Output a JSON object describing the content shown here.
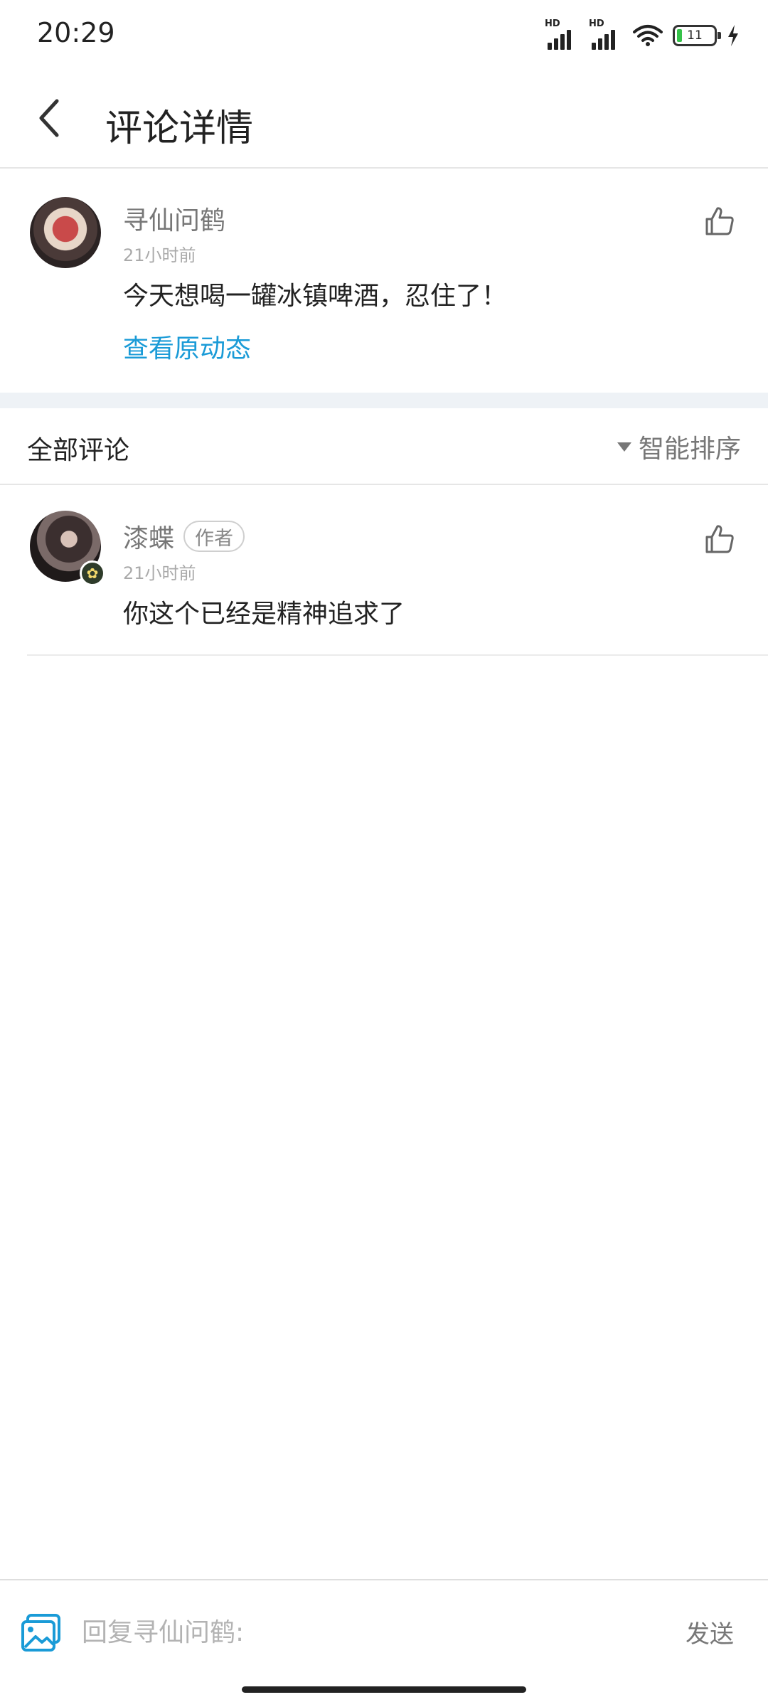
{
  "status_bar": {
    "time": "20:29",
    "signal_1_label": "HD",
    "signal_2_label": "HD",
    "battery_level": "11",
    "icons": [
      "signal-icon",
      "signal-icon",
      "wifi-icon",
      "battery-icon",
      "charging-icon"
    ]
  },
  "header": {
    "title": "评论详情",
    "back_icon": "chevron-left-icon"
  },
  "main_comment": {
    "username": "寻仙问鹤",
    "time": "21小时前",
    "content": "今天想喝一罐冰镇啤酒，忍住了！",
    "view_original": "查看原动态",
    "like_icon": "thumbs-up-icon"
  },
  "comments_section": {
    "title": "全部评论",
    "sort_label": "智能排序"
  },
  "replies": [
    {
      "username": "漆蝶",
      "tag": "作者",
      "time": "21小时前",
      "content": "你这个已经是精神追求了",
      "like_icon": "thumbs-up-icon"
    }
  ],
  "bottom_bar": {
    "placeholder": "回复寻仙问鹤:",
    "send_label": "发送",
    "image_icon": "image-icon"
  },
  "colors": {
    "link": "#1a9bd7",
    "divider_band": "#eef2f6",
    "battery_fill": "#36c24a"
  }
}
